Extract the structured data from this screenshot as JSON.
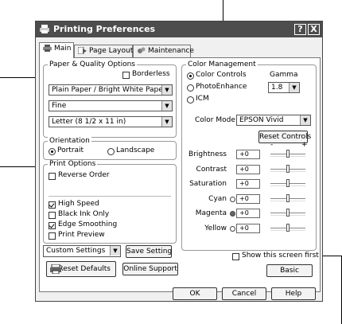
{
  "window": {
    "title": "Printing Preferences",
    "help_label": "?",
    "close_label": "X"
  },
  "tabs": {
    "main": "Main",
    "page_layout": "Page Layout",
    "maintenance": "Maintenance"
  },
  "paper": {
    "group": "Paper & Quality Options",
    "borderless": "Borderless",
    "media": "Plain Paper / Bright White Paper",
    "quality": "Fine",
    "size": "Letter (8 1/2 x 11 in)"
  },
  "orientation": {
    "group": "Orientation",
    "portrait": "Portrait",
    "landscape": "Landscape"
  },
  "print_options": {
    "group": "Print Options",
    "reverse_order": "Reverse Order",
    "high_speed": "High Speed",
    "black_ink_only": "Black Ink Only",
    "edge_smoothing": "Edge Smoothing",
    "print_preview": "Print Preview"
  },
  "custom": {
    "value": "Custom Settings",
    "save_setting": "Save Setting"
  },
  "color": {
    "group": "Color Management",
    "color_controls": "Color Controls",
    "photoenhance": "PhotoEnhance",
    "icm": "ICM",
    "gamma_label": "Gamma",
    "gamma_value": "1.8",
    "mode_label": "Color Mode",
    "mode_value": "EPSON Vivid",
    "reset_controls": "Reset Controls",
    "minus": "-",
    "plus": "+",
    "sliders": [
      {
        "label": "Brightness",
        "value": "+0",
        "level": 0.5
      },
      {
        "label": "Contrast",
        "value": "+0",
        "level": 0.5
      },
      {
        "label": "Saturation",
        "value": "+0",
        "level": 0.5
      },
      {
        "label": "Cyan",
        "value": "+0",
        "level": 0.5
      },
      {
        "label": "Magenta",
        "value": "+0",
        "level": 0.5
      },
      {
        "label": "Yellow",
        "value": "+0",
        "level": 0.5
      }
    ]
  },
  "show_screen_first": "Show this screen first",
  "buttons": {
    "reset_defaults": "Reset Defaults",
    "online_support": "Online Support",
    "basic": "Basic",
    "ok": "OK",
    "cancel": "Cancel",
    "help": "Help"
  }
}
